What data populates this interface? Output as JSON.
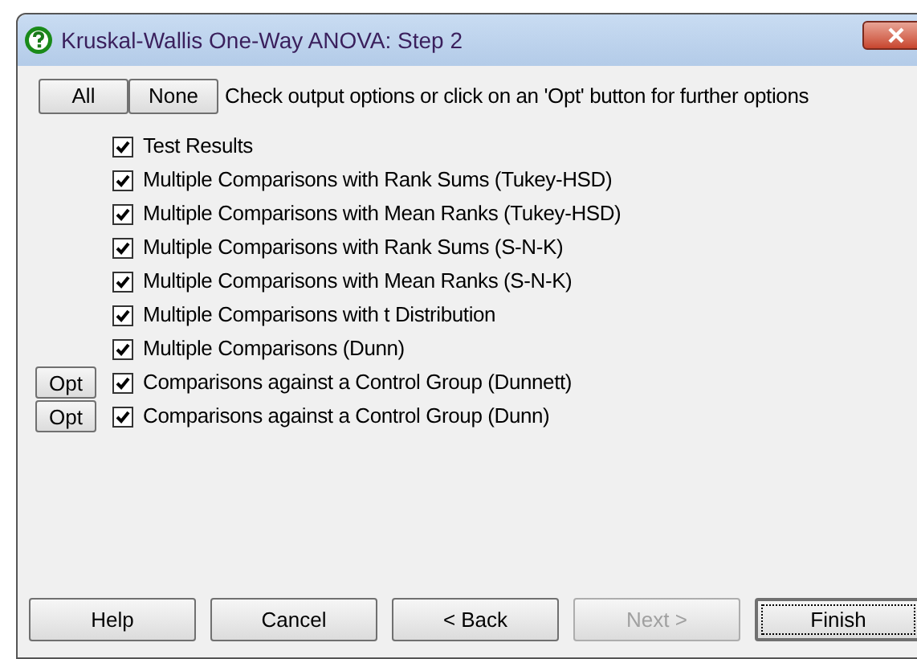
{
  "window": {
    "title": "Kruskal-Wallis One-Way ANOVA: Step 2"
  },
  "top_buttons": [
    "All",
    "None"
  ],
  "instruction": "Check output options or click on an 'Opt' button for further options",
  "options": [
    {
      "label": "Test Results",
      "checked": true
    },
    {
      "label": "Multiple Comparisons with Rank Sums (Tukey-HSD)",
      "checked": true
    },
    {
      "label": "Multiple Comparisons with Mean Ranks (Tukey-HSD)",
      "checked": true
    },
    {
      "label": "Multiple Comparisons with Rank Sums (S-N-K)",
      "checked": true
    },
    {
      "label": "Multiple Comparisons with Mean Ranks (S-N-K)",
      "checked": true
    },
    {
      "label": "Multiple Comparisons with t Distribution",
      "checked": true
    },
    {
      "label": "Multiple Comparisons (Dunn)",
      "checked": true
    },
    {
      "label": "Comparisons against a Control Group (Dunnett)",
      "checked": true,
      "opt_button": "Opt"
    },
    {
      "label": "Comparisons against a Control Group (Dunn)",
      "checked": true,
      "opt_button": "Opt"
    }
  ],
  "footer_buttons": [
    {
      "label": "Help",
      "disabled": false,
      "default": false
    },
    {
      "label": "Cancel",
      "disabled": false,
      "default": false
    },
    {
      "label": "< Back",
      "disabled": false,
      "default": false
    },
    {
      "label": "Next >",
      "disabled": true,
      "default": false
    },
    {
      "label": "Finish",
      "disabled": false,
      "default": true
    }
  ]
}
